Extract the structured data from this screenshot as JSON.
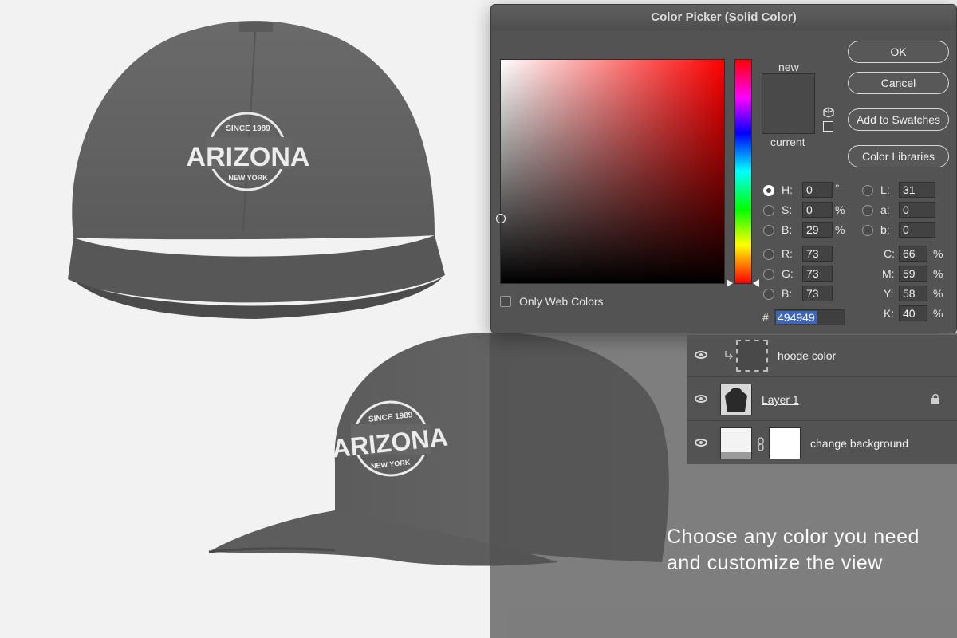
{
  "dialog": {
    "title": "Color Picker (Solid Color)",
    "new_label": "new",
    "current_label": "current",
    "preview_color": "#494949",
    "buttons": {
      "ok": "OK",
      "cancel": "Cancel",
      "swatches": "Add to Swatches",
      "libraries": "Color Libraries"
    },
    "web_colors_label": "Only Web Colors",
    "hsb": [
      {
        "label": "H:",
        "value": "0",
        "unit": "°",
        "selected": true
      },
      {
        "label": "S:",
        "value": "0",
        "unit": "%",
        "selected": false
      },
      {
        "label": "B:",
        "value": "29",
        "unit": "%",
        "selected": false
      }
    ],
    "rgb": [
      {
        "label": "R:",
        "value": "73"
      },
      {
        "label": "G:",
        "value": "73"
      },
      {
        "label": "B:",
        "value": "73"
      }
    ],
    "lab": [
      {
        "label": "L:",
        "value": "31"
      },
      {
        "label": "a:",
        "value": "0"
      },
      {
        "label": "b:",
        "value": "0"
      }
    ],
    "cmyk": [
      {
        "label": "C:",
        "value": "66",
        "unit": "%"
      },
      {
        "label": "M:",
        "value": "59",
        "unit": "%"
      },
      {
        "label": "Y:",
        "value": "58",
        "unit": "%"
      },
      {
        "label": "K:",
        "value": "40",
        "unit": "%"
      }
    ],
    "hex_prefix": "#",
    "hex_value": "494949"
  },
  "layers": [
    {
      "name": "hoode color"
    },
    {
      "name": "Layer 1"
    },
    {
      "name": "change background"
    }
  ],
  "promo": {
    "line1": "Choose any color you need",
    "line2": "and customize the view"
  },
  "caps": {
    "logo_top": "SINCE 1989",
    "logo_main": "ARIZONA",
    "logo_bottom": "NEW YORK"
  }
}
